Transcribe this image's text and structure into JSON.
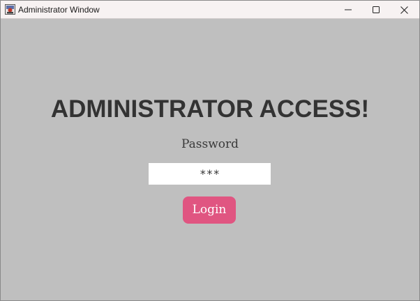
{
  "window": {
    "title": "Administrator Window",
    "controls": {
      "minimize_icon": "minimize-icon",
      "maximize_icon": "maximize-icon",
      "close_icon": "close-icon"
    }
  },
  "main": {
    "heading": "ADMINISTRATOR ACCESS!",
    "password_label": "Password",
    "password_value": "***",
    "login_label": "Login"
  },
  "colors": {
    "background": "#bfbfbf",
    "titlebar": "#f7f2f2",
    "login_button": "#e05581",
    "heading_text": "#333333"
  }
}
